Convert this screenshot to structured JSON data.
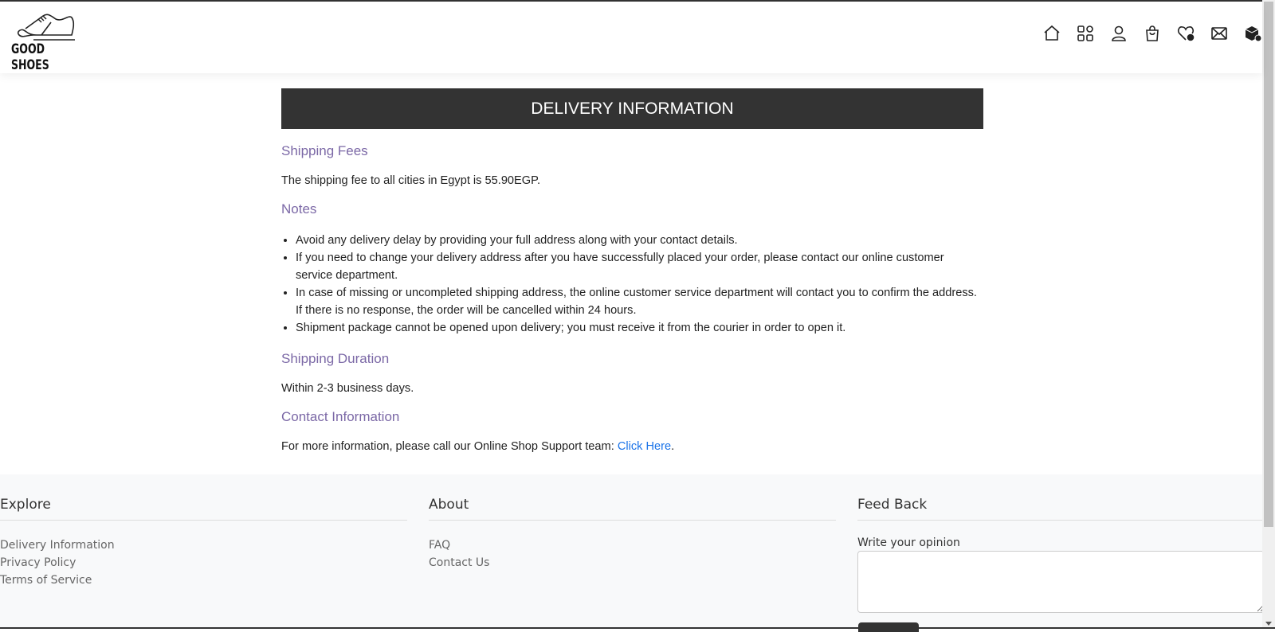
{
  "header": {
    "logo_text": "GOOD SHOES",
    "icons": [
      "home-icon",
      "categories-grid-icon",
      "user-icon",
      "shopping-bag-icon",
      "wishlist-heart-icon",
      "mail-icon",
      "orders-box-icon"
    ]
  },
  "main": {
    "title": "DELIVERY INFORMATION",
    "shipping_fees": {
      "heading": "Shipping Fees",
      "text": "The shipping fee to all cities in Egypt is 55.90EGP."
    },
    "notes": {
      "heading": "Notes",
      "items": [
        "Avoid any delivery delay by providing your full address along with your contact details.",
        "If you need to change your delivery address after you have successfully placed your order, please contact our online customer service department.",
        "In case of missing or uncompleted shipping address, the online customer service department will contact you to confirm the address. If there is no response, the order will be cancelled within 24 hours.",
        "Shipment package cannot be opened upon delivery; you must receive it from the courier in order to open it."
      ]
    },
    "shipping_duration": {
      "heading": "Shipping Duration",
      "text": "Within 2-3 business days."
    },
    "contact": {
      "heading": "Contact Information",
      "text": "For more information, please call our Online Shop Support team: ",
      "link": "Click Here",
      "suffix": "."
    }
  },
  "footer": {
    "explore": {
      "heading": "Explore",
      "links": [
        "Delivery Information",
        "Privacy Policy",
        "Terms of Service"
      ]
    },
    "about": {
      "heading": "About",
      "links": [
        "FAQ",
        "Contact Us"
      ]
    },
    "feedback": {
      "heading": "Feed Back",
      "label": "Write your opinion",
      "value": ""
    }
  },
  "colors": {
    "heading": "#7b68a6",
    "title_bar": "#333333",
    "link": "#1a73e8",
    "footer_bg": "#f8f9fa"
  }
}
